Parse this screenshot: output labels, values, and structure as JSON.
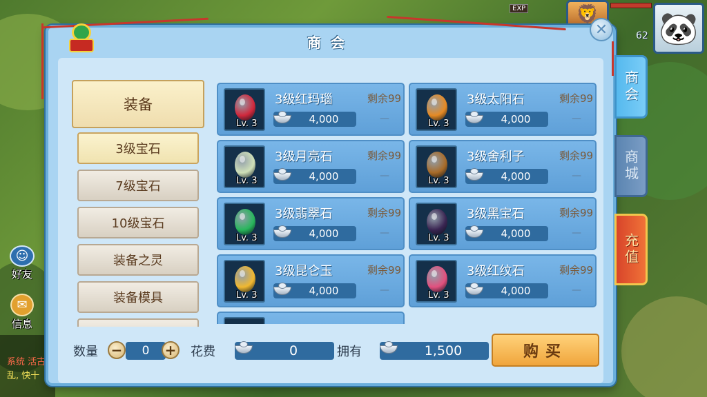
{
  "hud": {
    "exp_label": "EXP",
    "level": "62",
    "friend_label": "好友",
    "message_label": "信息",
    "chat_lines": [
      "系统 活古",
      "乱, 快十"
    ]
  },
  "panel": {
    "title": "商会",
    "close_icon": "close-icon"
  },
  "categories": {
    "main": "装备",
    "subs": [
      "3级宝石",
      "7级宝石",
      "10级宝石",
      "装备之灵",
      "装备模具",
      ""
    ],
    "active_index": 0
  },
  "items": [
    {
      "name": "3级红玛瑙",
      "level": "Lv. 3",
      "price": "4,000",
      "remain": "剩余99",
      "dash": "—",
      "gem_color": "#d0283c"
    },
    {
      "name": "3级太阳石",
      "level": "Lv. 3",
      "price": "4,000",
      "remain": "剩余99",
      "dash": "—",
      "gem_color": "#e58a24"
    },
    {
      "name": "3级月亮石",
      "level": "Lv. 3",
      "price": "4,000",
      "remain": "剩余99",
      "dash": "—",
      "gem_color": "#cfe0b8"
    },
    {
      "name": "3级舍利子",
      "level": "Lv. 3",
      "price": "4,000",
      "remain": "剩余99",
      "dash": "—",
      "gem_color": "#a86b28"
    },
    {
      "name": "3级翡翠石",
      "level": "Lv. 3",
      "price": "4,000",
      "remain": "剩余99",
      "dash": "—",
      "gem_color": "#28b65c"
    },
    {
      "name": "3级黑宝石",
      "level": "Lv. 3",
      "price": "4,000",
      "remain": "剩余99",
      "dash": "—",
      "gem_color": "#3a2552"
    },
    {
      "name": "3级昆仑玉",
      "level": "Lv. 3",
      "price": "4,000",
      "remain": "剩余99",
      "dash": "—",
      "gem_color": "#f0b830"
    },
    {
      "name": "3级红纹石",
      "level": "Lv. 3",
      "price": "4,000",
      "remain": "剩余99",
      "dash": "—",
      "gem_color": "#e2507e"
    }
  ],
  "bottom": {
    "qty_label": "数量",
    "qty_value": "0",
    "cost_label": "花费",
    "cost_value": "0",
    "own_label": "拥有",
    "own_value": "1,500",
    "buy_label": "购买",
    "minus_icon": "minus-icon",
    "plus_icon": "plus-icon"
  },
  "tabs": {
    "shanghui": "商会",
    "shangcheng": "商城",
    "chongzhi": "充值",
    "active": "shanghui"
  }
}
